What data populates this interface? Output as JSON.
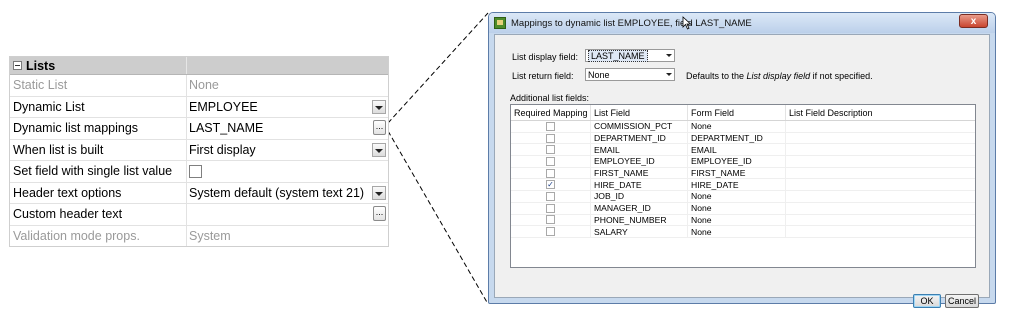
{
  "property_grid": {
    "section_title": "Lists",
    "rows": [
      {
        "label": "Static List",
        "value": "None"
      },
      {
        "label": "Dynamic List",
        "value": "EMPLOYEE"
      },
      {
        "label": "Dynamic list mappings",
        "value": "LAST_NAME"
      },
      {
        "label": "When list is built",
        "value": "First display"
      },
      {
        "label": "Set field with single list value",
        "value": ""
      },
      {
        "label": "Header text options",
        "value": "System default (system text 21)"
      },
      {
        "label": "Custom header text",
        "value": ""
      },
      {
        "label": "Validation mode props.",
        "value": "System"
      }
    ],
    "ellipsis_label": "..."
  },
  "dialog": {
    "title": "Mappings to dynamic list EMPLOYEE, field LAST_NAME",
    "close_label": "x",
    "list_display_field": {
      "label": "List display field:",
      "value": "LAST_NAME"
    },
    "list_return_field": {
      "label": "List return field:",
      "value": "None"
    },
    "hint": {
      "prefix": "Defaults to the ",
      "emphasis": "List display field",
      "suffix": " if not specified."
    },
    "additional_label": "Additional list fields:",
    "columns": [
      "Required Mapping",
      "List Field",
      "Form Field",
      "List Field Description"
    ],
    "rows": [
      {
        "checked": false,
        "list_field": "COMMISSION_PCT",
        "form_field": "None",
        "description": ""
      },
      {
        "checked": false,
        "list_field": "DEPARTMENT_ID",
        "form_field": "DEPARTMENT_ID",
        "description": ""
      },
      {
        "checked": false,
        "list_field": "EMAIL",
        "form_field": "EMAIL",
        "description": ""
      },
      {
        "checked": false,
        "list_field": "EMPLOYEE_ID",
        "form_field": "EMPLOYEE_ID",
        "description": ""
      },
      {
        "checked": false,
        "list_field": "FIRST_NAME",
        "form_field": "FIRST_NAME",
        "description": ""
      },
      {
        "checked": true,
        "list_field": "HIRE_DATE",
        "form_field": "HIRE_DATE",
        "description": ""
      },
      {
        "checked": false,
        "list_field": "JOB_ID",
        "form_field": "None",
        "description": ""
      },
      {
        "checked": false,
        "list_field": "MANAGER_ID",
        "form_field": "None",
        "description": ""
      },
      {
        "checked": false,
        "list_field": "PHONE_NUMBER",
        "form_field": "None",
        "description": ""
      },
      {
        "checked": false,
        "list_field": "SALARY",
        "form_field": "None",
        "description": ""
      }
    ],
    "ok_label": "OK",
    "cancel_label": "Cancel"
  }
}
